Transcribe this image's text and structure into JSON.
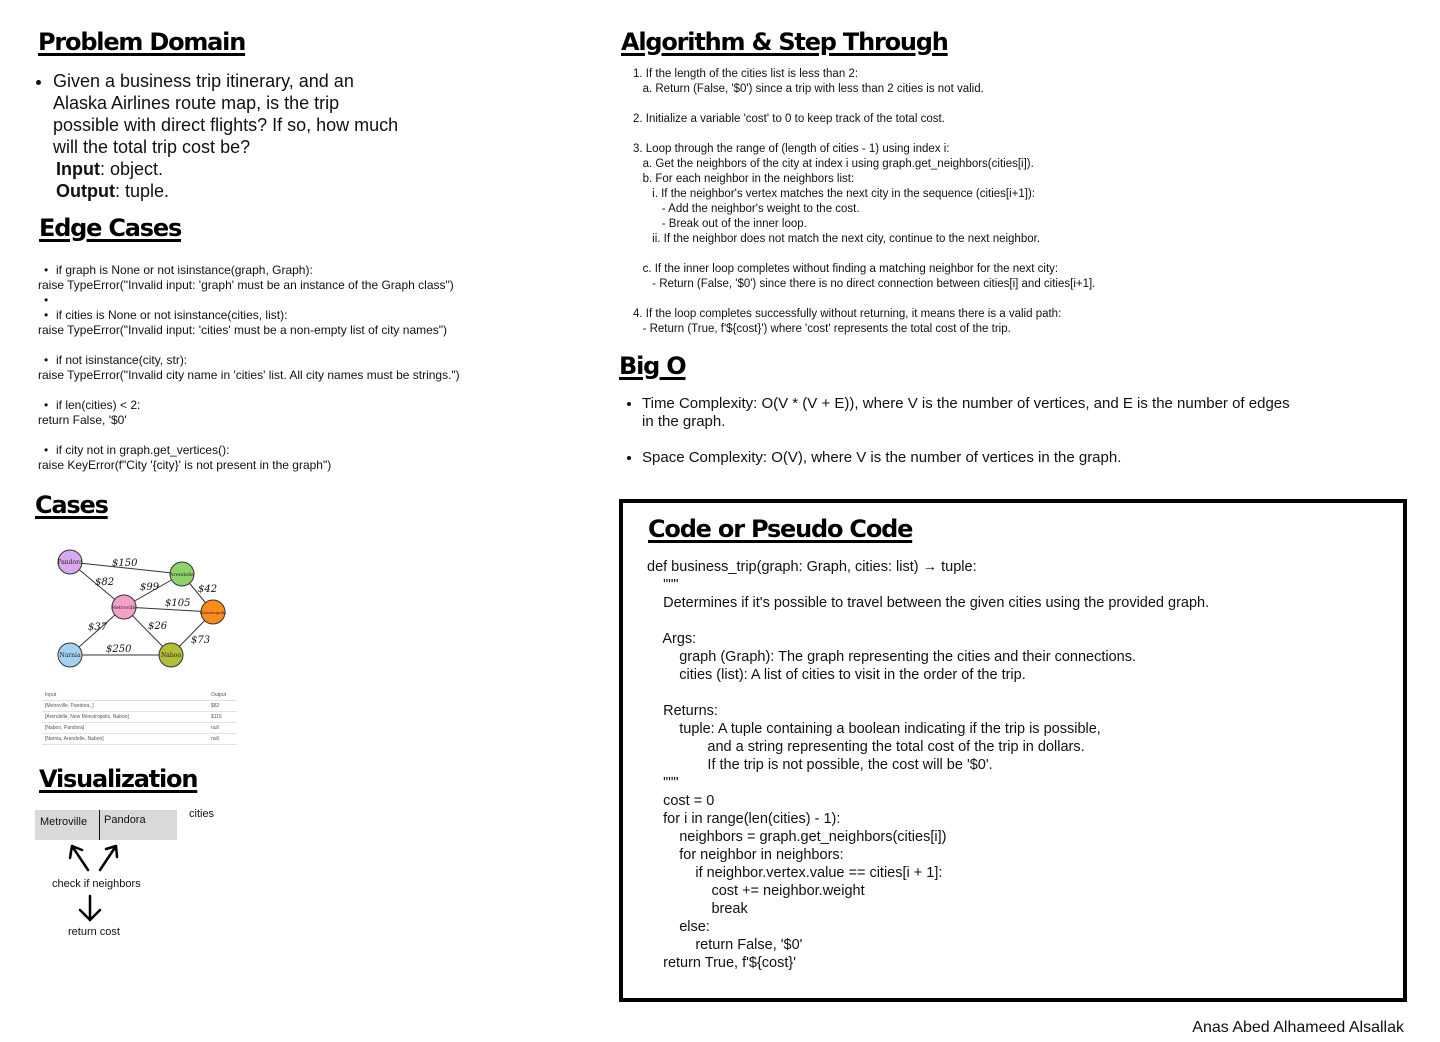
{
  "problem": {
    "title": "Problem Domain",
    "bullet": "Given a business trip itinerary, and an Alaska Airlines route map, is the trip possible with direct flights? If so, how much will the total trip cost be?",
    "input_label": "Input",
    "input_value": ": object.",
    "output_label": "Output",
    "output_value": ": tuple."
  },
  "edge": {
    "title": "Edge Cases",
    "lines": [
      {
        "bullet": true,
        "text": "if graph is None or not isinstance(graph, Graph):"
      },
      {
        "bullet": false,
        "text": "raise TypeError(\"Invalid input: 'graph' must be an instance of the Graph class\")"
      },
      {
        "bullet": true,
        "text": ""
      },
      {
        "bullet": true,
        "text": "if cities is None or not isinstance(cities, list):"
      },
      {
        "bullet": false,
        "text": "raise TypeError(\"Invalid input: 'cities' must be a non-empty list of city names\")"
      },
      {
        "bullet": false,
        "text": ""
      },
      {
        "bullet": true,
        "text": "if not isinstance(city, str):"
      },
      {
        "bullet": false,
        "text": "raise TypeError(\"Invalid city name in 'cities' list. All city names must be strings.\")"
      },
      {
        "bullet": false,
        "text": ""
      },
      {
        "bullet": true,
        "text": "if len(cities) < 2:"
      },
      {
        "bullet": false,
        "text": "return False, '$0'"
      },
      {
        "bullet": false,
        "text": ""
      },
      {
        "bullet": true,
        "text": "if city not in graph.get_vertices():"
      },
      {
        "bullet": false,
        "text": "raise KeyError(f\"City '{city}' is not present in the graph\")"
      }
    ]
  },
  "cases": {
    "title": "Cases",
    "graph": {
      "nodes": [
        {
          "id": "pandora",
          "label": "Pandora",
          "color": "#d8a8f0"
        },
        {
          "id": "arendelle",
          "label": "Arendelle",
          "color": "#8ed36a"
        },
        {
          "id": "metroville",
          "label": "Metroville",
          "color": "#f4a0c8"
        },
        {
          "id": "monstropolis",
          "label": "Monstropolis",
          "color": "#ff8a1e"
        },
        {
          "id": "narnia",
          "label": "Narnia",
          "color": "#a6d2f2"
        },
        {
          "id": "naboo",
          "label": "Naboo",
          "color": "#b2bd3a"
        }
      ],
      "edge_labels": [
        "$150",
        "$82",
        "$99",
        "$42",
        "$105",
        "$37",
        "$26",
        "$73",
        "$250"
      ]
    },
    "table": {
      "headers": [
        "Input",
        "Output"
      ],
      "rows": [
        [
          "[Metroville, Pandora, ]",
          "$82"
        ],
        [
          "[Arendelle, New Monstropolis, Naboo]",
          "$115"
        ],
        [
          "[Naboo, Pandora]",
          "null"
        ],
        [
          "[Narnia, Arendelle, Naboo]",
          "null"
        ]
      ]
    }
  },
  "viz": {
    "title": "Visualization",
    "cells": [
      "Metroville",
      "Pandora"
    ],
    "cities_label": "cities",
    "check_label": "check if neighbors",
    "return_label": "return cost"
  },
  "algo": {
    "title": "Algorithm & Step Through",
    "lines": [
      "1. If the length of the cities list is less than 2:",
      "   a. Return (False, '$0') since a trip with less than 2 cities is not valid.",
      "",
      "2. Initialize a variable 'cost' to 0 to keep track of the total cost.",
      "",
      "3. Loop through the range of (length of cities - 1) using index i:",
      "   a. Get the neighbors of the city at index i using graph.get_neighbors(cities[i]).",
      "   b. For each neighbor in the neighbors list:",
      "      i. If the neighbor's vertex matches the next city in the sequence (cities[i+1]):",
      "         - Add the neighbor's weight to the cost.",
      "         - Break out of the inner loop.",
      "      ii. If the neighbor does not match the next city, continue to the next neighbor.",
      "",
      "   c. If the inner loop completes without finding a matching neighbor for the next city:",
      "      - Return (False, '$0') since there is no direct connection between cities[i] and cities[i+1].",
      "",
      "4. If the loop completes successfully without returning, it means there is a valid path:",
      "   - Return (True, f'${cost}') where 'cost' represents the total cost of the trip."
    ]
  },
  "bigo": {
    "title": "Big O",
    "time": "Time Complexity: O(V * (V + E)), where V is the number of vertices, and E is the number of edges in the graph.",
    "space": "Space Complexity: O(V), where V is the number of vertices in the graph."
  },
  "code": {
    "title": "Code or Pseudo Code",
    "lines": [
      "def business_trip(graph: Graph, cities: list) → tuple:",
      "    \"\"\"",
      "    Determines if it's possible to travel between the given cities using the provided graph.",
      "",
      "    Args:",
      "        graph (Graph): The graph representing the cities and their connections.",
      "        cities (list): A list of cities to visit in the order of the trip.",
      "",
      "    Returns:",
      "        tuple: A tuple containing a boolean indicating if the trip is possible,",
      "               and a string representing the total cost of the trip in dollars.",
      "               If the trip is not possible, the cost will be '$0'.",
      "    \"\"\"",
      "    cost = 0",
      "    for i in range(len(cities) - 1):",
      "        neighbors = graph.get_neighbors(cities[i])",
      "        for neighbor in neighbors:",
      "            if neighbor.vertex.value == cities[i + 1]:",
      "                cost += neighbor.weight",
      "                break",
      "        else:",
      "            return False, '$0'",
      "    return True, f'${cost}'"
    ]
  },
  "author": "Anas Abed Alhameed Alsallak"
}
